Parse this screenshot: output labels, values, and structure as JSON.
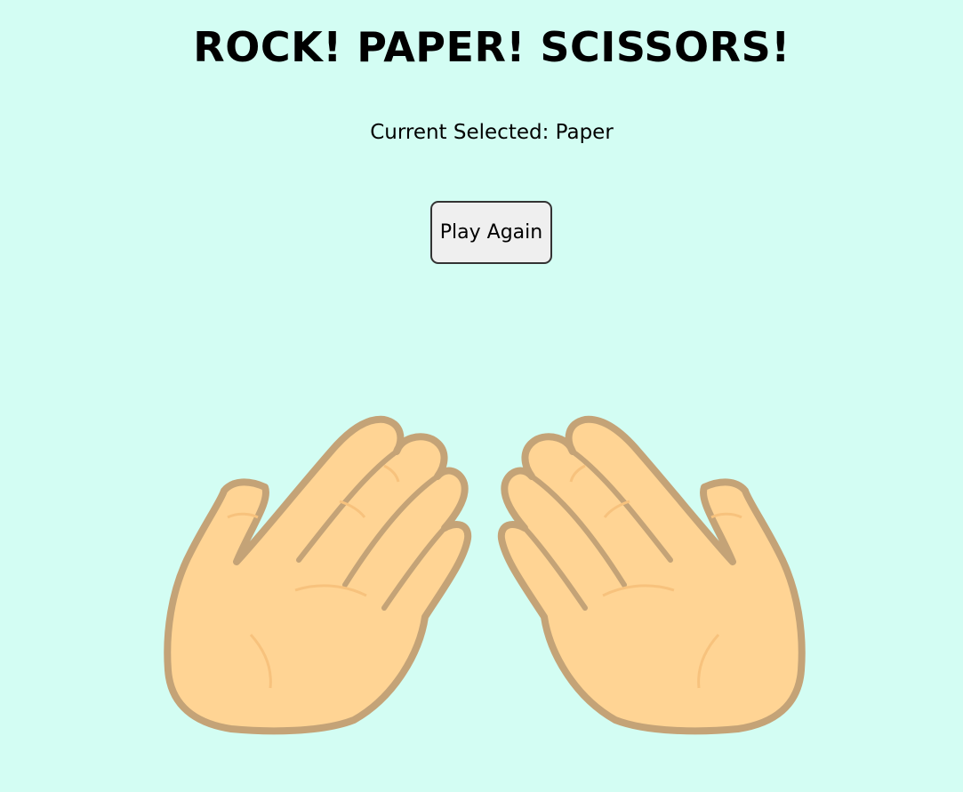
{
  "game": {
    "title": "ROCK! PAPER! SCISSORS!",
    "current_selected": "Current Selected: Paper",
    "play_again_label": "Play Again"
  },
  "illustration": {
    "icon": "open-hands-paper-icon",
    "colors": {
      "background": "#d3fdf3",
      "skin": "#ffd494",
      "outline": "#c4a377",
      "crease": "#f7c27d"
    }
  }
}
